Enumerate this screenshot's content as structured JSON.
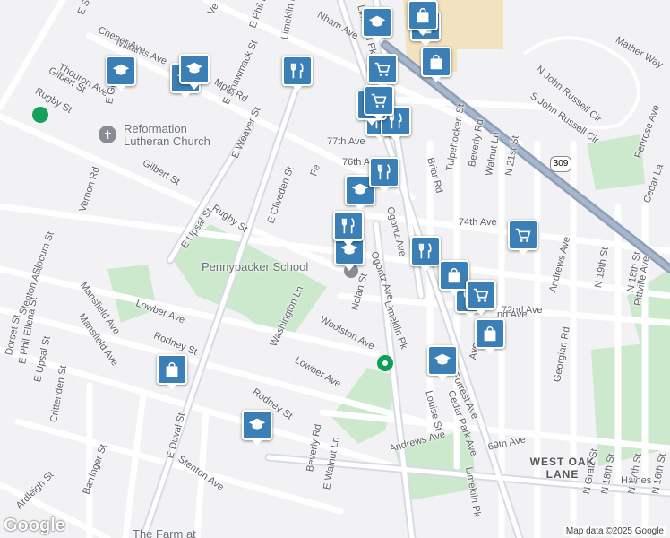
{
  "map": {
    "attribution": "Map data ©2025 Google",
    "logo": "Google",
    "pin_colors": {
      "school": "#3b7fb7",
      "restaurant": "#3b7fb7",
      "shopping": "#3b7fb7"
    },
    "roads": [
      {
        "name": "Vernon Rd"
      },
      {
        "name": "Gilbert St"
      },
      {
        "name": "Rugby St"
      },
      {
        "name": "Thouron Ave"
      },
      {
        "name": "Williams Ave"
      },
      {
        "name": "E Sedgwick St"
      },
      {
        "name": "E Phil Ellena St"
      },
      {
        "name": "E Shawmack St"
      },
      {
        "name": "E Weaver St"
      },
      {
        "name": "E Upsal St"
      },
      {
        "name": "Limekiln Pk"
      },
      {
        "name": "77th Ave"
      },
      {
        "name": "76th Ave"
      },
      {
        "name": "74th Ave"
      },
      {
        "name": "72nd Ave"
      },
      {
        "name": "69th Ave"
      },
      {
        "name": "E Cliveden St"
      },
      {
        "name": "Washington Ln"
      },
      {
        "name": "Ogontz Ave"
      },
      {
        "name": "Briar Rd"
      },
      {
        "name": "Tulpehocken St"
      },
      {
        "name": "Beverly Rd"
      },
      {
        "name": "Walnut Ln"
      },
      {
        "name": "N 21st St"
      },
      {
        "name": "N John Russell Cir"
      },
      {
        "name": "S John Russell Cir"
      },
      {
        "name": "Mather Way"
      },
      {
        "name": "Penrose Ave"
      },
      {
        "name": "Cedar La"
      },
      {
        "name": "Andrews Ave"
      },
      {
        "name": "N 19th St"
      },
      {
        "name": "N 18th St"
      },
      {
        "name": "Pittville Ave"
      },
      {
        "name": "Georgian Rd"
      },
      {
        "name": "Lowber Ave"
      },
      {
        "name": "Woolston Ave"
      },
      {
        "name": "Nolan St"
      },
      {
        "name": "Rodney St"
      },
      {
        "name": "Mansfield Ave"
      },
      {
        "name": "Stenton Ave"
      },
      {
        "name": "Slocum St"
      },
      {
        "name": "Dorset St"
      },
      {
        "name": "E Upsal St"
      },
      {
        "name": "Crittenden St"
      },
      {
        "name": "Barringer St"
      },
      {
        "name": "Ardleigh St"
      },
      {
        "name": "E Duval St"
      },
      {
        "name": "Beverly Rd"
      },
      {
        "name": "E Walnut Ln"
      },
      {
        "name": "Louise St"
      },
      {
        "name": "Forrest Ave"
      },
      {
        "name": "Cedar Park Ave"
      },
      {
        "name": "Haines"
      },
      {
        "name": "N Gratz St"
      },
      {
        "name": "N 18th St"
      },
      {
        "name": "N 17th St"
      },
      {
        "name": "N 16th St"
      },
      {
        "name": "E Phil Ellena St"
      },
      {
        "name": "Rugby St"
      },
      {
        "name": "Gilbert St"
      },
      {
        "name": "Andrews Ave"
      },
      {
        "name": "Limekiln Pk"
      },
      {
        "name": "Limekiln Pk"
      },
      {
        "name": "Rodney St"
      },
      {
        "name": "Stenton Ave"
      },
      {
        "name": "Ogontz Ave"
      },
      {
        "name": "Chener Ave"
      },
      {
        "name": "Nham Ave"
      },
      {
        "name": "Ve"
      },
      {
        "name": "Lowber Ave"
      },
      {
        "name": "Mansfield Ave"
      },
      {
        "name": "Mple Rd"
      },
      {
        "name": "E Go"
      },
      {
        "name": "Fe"
      },
      {
        "name": "Ave"
      },
      {
        "name": "nd Ave"
      },
      {
        "name": "Limekiln Pk"
      }
    ],
    "places": [
      {
        "name": "Reformation Lutheran Church"
      },
      {
        "name": "Pennypacker School"
      },
      {
        "name": "The Farm at"
      }
    ],
    "area_label": "WEST OAK LANE",
    "highway_shield": "309",
    "pins": [
      {
        "type": "school",
        "icon": "school-icon"
      },
      {
        "type": "school",
        "icon": "school-icon"
      },
      {
        "type": "school",
        "icon": "school-icon"
      },
      {
        "type": "school",
        "icon": "school-icon"
      },
      {
        "type": "school",
        "icon": "school-icon"
      },
      {
        "type": "school",
        "icon": "school-icon"
      },
      {
        "type": "school",
        "icon": "school-icon"
      },
      {
        "type": "school",
        "icon": "school-icon"
      },
      {
        "type": "restaurant",
        "icon": "restaurant-icon"
      },
      {
        "type": "restaurant",
        "icon": "restaurant-icon"
      },
      {
        "type": "restaurant",
        "icon": "restaurant-icon"
      },
      {
        "type": "restaurant",
        "icon": "restaurant-icon"
      },
      {
        "type": "restaurant",
        "icon": "restaurant-icon"
      },
      {
        "type": "restaurant",
        "icon": "restaurant-icon"
      },
      {
        "type": "restaurant",
        "icon": "restaurant-icon"
      },
      {
        "type": "restaurant",
        "icon": "restaurant-icon"
      },
      {
        "type": "shopping",
        "icon": "shopping-bag-icon"
      },
      {
        "type": "shopping",
        "icon": "shopping-bag-icon"
      },
      {
        "type": "shopping",
        "icon": "shopping-bag-icon"
      },
      {
        "type": "shopping",
        "icon": "shopping-bag-icon"
      },
      {
        "type": "shopping",
        "icon": "shopping-bag-icon"
      },
      {
        "type": "shopping",
        "icon": "shopping-bag-icon"
      },
      {
        "type": "grocery",
        "icon": "shopping-cart-icon"
      },
      {
        "type": "grocery",
        "icon": "shopping-cart-icon"
      },
      {
        "type": "grocery",
        "icon": "shopping-cart-icon"
      },
      {
        "type": "grocery",
        "icon": "shopping-cart-icon"
      }
    ]
  }
}
